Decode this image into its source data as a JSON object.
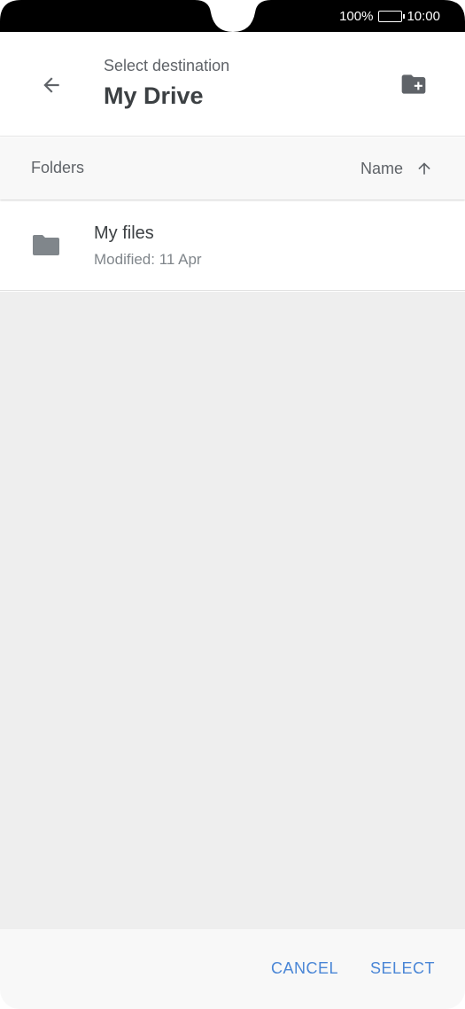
{
  "status_bar": {
    "battery": "100%",
    "time": "10:00"
  },
  "header": {
    "subtitle": "Select destination",
    "title": "My Drive",
    "back_icon": "arrow-back-icon",
    "new_folder_icon": "create-new-folder-icon"
  },
  "columns": {
    "folders_label": "Folders",
    "sort_label": "Name",
    "sort_icon": "arrow-up-icon"
  },
  "folders": [
    {
      "name": "My files",
      "modified": "Modified: 11 Apr",
      "icon": "folder-icon"
    }
  ],
  "footer": {
    "cancel_label": "CANCEL",
    "select_label": "SELECT"
  },
  "colors": {
    "accent": "#4a86d6",
    "icon_gray": "#80868b",
    "status_bar_bg": "#000000",
    "empty_area_bg": "#eeeeee"
  }
}
